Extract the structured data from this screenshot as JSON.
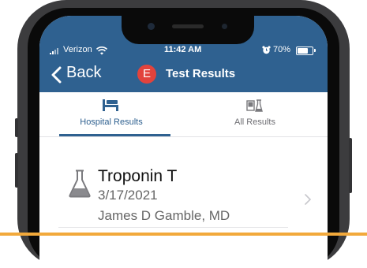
{
  "status_bar": {
    "carrier": "Verizon",
    "time": "11:42 AM",
    "battery_percent": "70%",
    "battery_level": 0.7
  },
  "nav": {
    "back_label": "Back",
    "avatar_letter": "E",
    "title": "Test Results"
  },
  "tabs": [
    {
      "label": "Hospital Results",
      "icon": "hospital-bed-icon",
      "selected": true
    },
    {
      "label": "All Results",
      "icon": "lab-results-icon",
      "selected": false
    }
  ],
  "results": [
    {
      "icon": "flask-icon",
      "name": "Troponin T",
      "date": "3/17/2021",
      "doctor": "James D Gamble, MD"
    }
  ],
  "colors": {
    "header": "#2f6190",
    "avatar": "#e2433c",
    "accent_bar": "#f2a93b",
    "tab_selected": "#2f6190"
  }
}
